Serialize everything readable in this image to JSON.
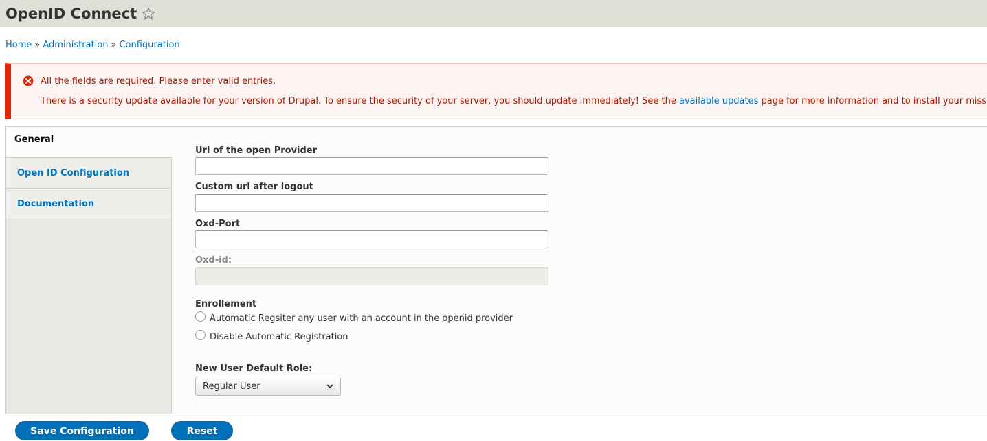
{
  "header": {
    "title": "OpenID Connect",
    "star_icon": "star-outline-icon"
  },
  "breadcrumb": {
    "items": [
      "Home",
      "Administration",
      "Configuration"
    ],
    "separator": "»"
  },
  "messages": {
    "error_icon": "error-x-icon",
    "error": "All the fields are required. Please enter valid entries.",
    "warning_prefix": "There is a security update available for your version of Drupal. To ensure the security of your server, you should update immediately! See the ",
    "warning_link": "available updates",
    "warning_suffix": " page for more information and to install your missin",
    "colors": {
      "text": "#a51b00",
      "border": "#e62600",
      "link": "#0074bd"
    }
  },
  "tabs": [
    {
      "label": "General",
      "selected": true
    },
    {
      "label": "Open ID Configuration",
      "selected": false
    },
    {
      "label": "Documentation",
      "selected": false
    }
  ],
  "form": {
    "provider_url": {
      "label": "Url of the open Provider",
      "value": ""
    },
    "logout_url": {
      "label": "Custom url after logout",
      "value": ""
    },
    "oxd_port": {
      "label": "Oxd-Port",
      "value": ""
    },
    "oxd_id": {
      "label": "Oxd-id:",
      "value": "",
      "disabled": true
    },
    "enrollment": {
      "label": "Enrollement",
      "options": [
        "Automatic Regsiter any user with an account in the openid provider",
        "Disable Automatic Registration"
      ]
    },
    "default_role": {
      "label": "New User Default Role:",
      "selected": "Regular User",
      "icon": "chevron-down-icon"
    }
  },
  "actions": {
    "save_label": "Save Configuration",
    "reset_label": "Reset",
    "color": "#0071b8"
  }
}
